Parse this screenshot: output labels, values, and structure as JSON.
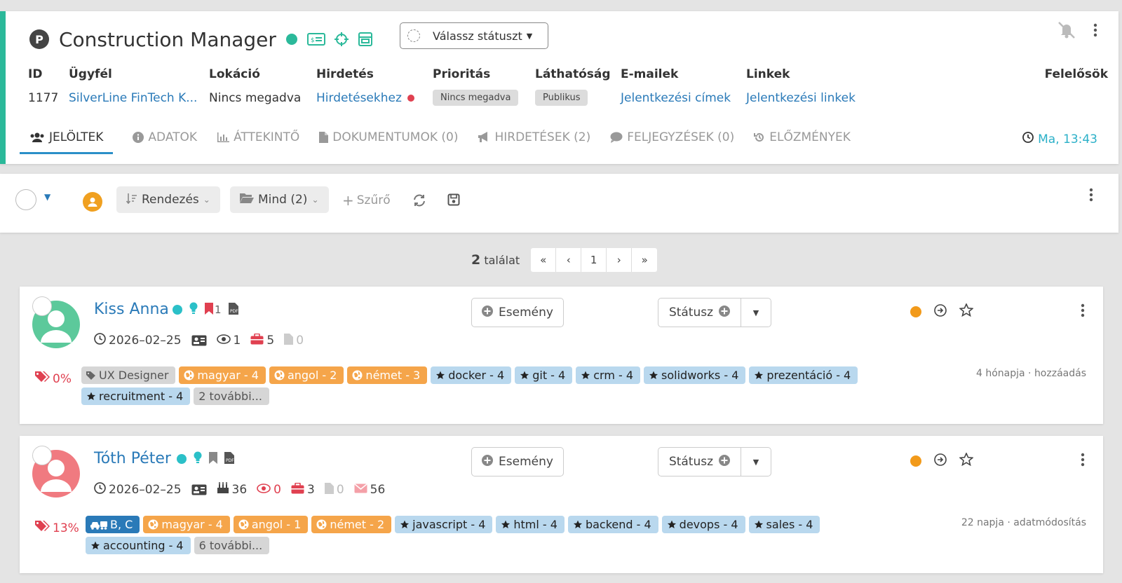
{
  "header": {
    "badge": "P",
    "title": "Construction Manager",
    "status_select": "Válassz státuszt",
    "fields": [
      {
        "label": "ID",
        "value": "1177"
      },
      {
        "label": "Ügyfél",
        "value": "SilverLine FinTech K..."
      },
      {
        "label": "Lokáció",
        "value": "Nincs megadva"
      },
      {
        "label": "Hirdetés",
        "value": "Hirdetésekhez"
      },
      {
        "label": "Prioritás",
        "value": "Nincs megadva"
      },
      {
        "label": "Láthatóság",
        "value": "Publikus"
      },
      {
        "label": "E-mailek",
        "value": "Jelentkezési címek"
      },
      {
        "label": "Linkek",
        "value": "Jelentkezési linkek"
      },
      {
        "label": "Felelősök",
        "value": ""
      }
    ],
    "tabs": [
      {
        "label": "JELÖLTEK",
        "icon": "users-icon"
      },
      {
        "label": "ADATOK",
        "icon": "info-icon"
      },
      {
        "label": "ÁTTEKINTŐ",
        "icon": "bar-chart-icon"
      },
      {
        "label": "DOKUMENTUMOK (0)",
        "icon": "document-icon"
      },
      {
        "label": "HIRDETÉSEK (2)",
        "icon": "megaphone-icon"
      },
      {
        "label": "FELJEGYZÉSEK (0)",
        "icon": "comment-icon"
      },
      {
        "label": "ELŐZMÉNYEK",
        "icon": "history-icon"
      }
    ],
    "time": "Ma, 13:43"
  },
  "toolbar": {
    "sort_label": "Rendezés",
    "folder_label": "Mind (2)",
    "filter_label": "Szűrő"
  },
  "pager": {
    "count": "2",
    "count_suffix": "találat",
    "first": "«",
    "prev": "‹",
    "page": "1",
    "next": "›",
    "last": "»"
  },
  "candidates": [
    {
      "name": "Kiss Anna",
      "avatar_color": "#5cc99b",
      "flag_count": "1",
      "date": "2026–02–25",
      "views": "1",
      "jobs": "5",
      "docs": "0",
      "event_label": "Esemény",
      "status_label": "Státusz",
      "percent": "0%",
      "timestamp": "4 hónapja · hozzáadás",
      "tags": [
        {
          "text": "UX Designer",
          "kind": "grey",
          "icon": "tag"
        },
        {
          "text": "magyar - 4",
          "kind": "orange",
          "icon": "globe"
        },
        {
          "text": "angol - 2",
          "kind": "orange",
          "icon": "globe"
        },
        {
          "text": "német - 3",
          "kind": "orange",
          "icon": "globe"
        },
        {
          "text": "docker - 4",
          "kind": "blue",
          "icon": "star"
        },
        {
          "text": "git - 4",
          "kind": "blue",
          "icon": "star"
        },
        {
          "text": "crm - 4",
          "kind": "blue",
          "icon": "star"
        },
        {
          "text": "solidworks - 4",
          "kind": "blue",
          "icon": "star"
        },
        {
          "text": "prezentáció - 4",
          "kind": "blue",
          "icon": "star"
        },
        {
          "text": "recruitment - 4",
          "kind": "blue",
          "icon": "star"
        },
        {
          "text": "2 további...",
          "kind": "grey",
          "icon": ""
        }
      ]
    },
    {
      "name": "Tóth Péter",
      "avatar_color": "#f07a80",
      "date": "2026–02–25",
      "age": "36",
      "views": "0",
      "jobs": "3",
      "docs": "0",
      "emails": "56",
      "event_label": "Esemény",
      "status_label": "Státusz",
      "percent": "13%",
      "timestamp": "22 napja · adatmódosítás",
      "tags": [
        {
          "text": "B, C",
          "kind": "dblue",
          "icon": "car"
        },
        {
          "text": "magyar - 4",
          "kind": "orange",
          "icon": "globe"
        },
        {
          "text": "angol - 1",
          "kind": "orange",
          "icon": "globe"
        },
        {
          "text": "német - 2",
          "kind": "orange",
          "icon": "globe"
        },
        {
          "text": "javascript - 4",
          "kind": "blue",
          "icon": "star"
        },
        {
          "text": "html - 4",
          "kind": "blue",
          "icon": "star"
        },
        {
          "text": "backend - 4",
          "kind": "blue",
          "icon": "star"
        },
        {
          "text": "devops - 4",
          "kind": "blue",
          "icon": "star"
        },
        {
          "text": "sales - 4",
          "kind": "blue",
          "icon": "star"
        },
        {
          "text": "accounting - 4",
          "kind": "blue",
          "icon": "star"
        },
        {
          "text": "6 további...",
          "kind": "grey",
          "icon": ""
        }
      ]
    }
  ]
}
